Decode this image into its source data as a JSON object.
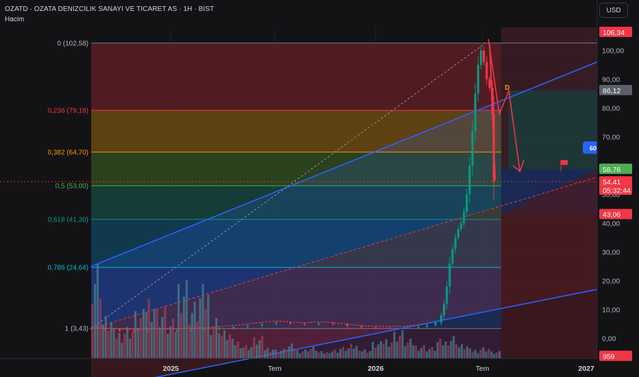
{
  "header": {
    "symbol_line": "OZATD · OZATA DENIZCILIK SANAYI VE TICARET AS · 1H · BIST",
    "volume_label": "Hacim"
  },
  "currency_button": "USD",
  "chart_data": {
    "type": "candlestick",
    "title": "OZATD · OZATA DENIZCILIK SANAYI VE TICARET AS · 1H · BIST",
    "y_axis": {
      "ylim": [
        -7,
        108
      ],
      "tick_labels": [
        "100,00",
        "90,00",
        "80,00",
        "70,00",
        "60,00",
        "50,00",
        "40,00",
        "30,00",
        "20,00",
        "10,00",
        "0,00"
      ],
      "tick_values": [
        100,
        90,
        80,
        70,
        60,
        50,
        40,
        30,
        20,
        10,
        0
      ]
    },
    "x_axis": {
      "tick_labels": [
        "2025",
        "Tem",
        "2026",
        "Tem",
        "2027"
      ],
      "tick_positions": [
        0.28,
        0.645,
        1.0,
        1.375,
        1.74
      ]
    },
    "fibonacci": {
      "levels": [
        {
          "label": "0 (102,58)",
          "value": 102.58,
          "line": "#787b86",
          "fill": "#5c1f24",
          "text": "#b2b5be"
        },
        {
          "label": "0,236 (79,18)",
          "value": 79.18,
          "line": "#f23645",
          "fill": "#6b4a12",
          "text": "#f23645"
        },
        {
          "label": "0,382 (64,70)",
          "value": 64.7,
          "line": "#ff9800",
          "fill": "#2f4a1f",
          "text": "#ff9800"
        },
        {
          "label": "0,5 (53,00)",
          "value": 53.0,
          "line": "#4caf50",
          "fill": "#16443c",
          "text": "#4caf50"
        },
        {
          "label": "0,618 (41,30)",
          "value": 41.3,
          "line": "#089981",
          "fill": "#124158",
          "text": "#089981"
        },
        {
          "label": "0,786 (24,64)",
          "value": 24.64,
          "line": "#00bcd4",
          "fill": "#1d2f5c",
          "text": "#00bcd4"
        },
        {
          "label": "1 (3,43)",
          "value": 3.43,
          "line": "#787b86",
          "fill": null,
          "text": "#b2b5be"
        }
      ]
    },
    "price_labels": [
      {
        "text": "106,34",
        "value": 106.34,
        "color": "#f23645"
      },
      {
        "text": "86,12",
        "value": 86.12,
        "color": "#5d606b"
      },
      {
        "text": "58,76",
        "value": 58.76,
        "color": "#4caf50"
      },
      {
        "text": "54,41",
        "value": 54.41,
        "color": "#f23645"
      },
      {
        "text": "05:32:44",
        "value": 51.5,
        "color": "#f23645"
      },
      {
        "text": "43,06",
        "value": 43.06,
        "color": "#f23645"
      },
      {
        "text": "959",
        "value": -6.2,
        "color": "#f23645"
      }
    ],
    "annotations": {
      "pattern_point": "D",
      "alert_badge": "60"
    },
    "series_close": [
      {
        "t": 0.0,
        "v": 3.4
      },
      {
        "t": 0.05,
        "v": 3.0
      },
      {
        "t": 0.1,
        "v": 2.6
      },
      {
        "t": 0.15,
        "v": 2.4
      },
      {
        "t": 0.2,
        "v": 2.5
      },
      {
        "t": 0.25,
        "v": 2.6
      },
      {
        "t": 0.3,
        "v": 2.7
      },
      {
        "t": 0.35,
        "v": 2.9
      },
      {
        "t": 0.4,
        "v": 3.1
      },
      {
        "t": 0.45,
        "v": 3.5
      },
      {
        "t": 0.5,
        "v": 3.9
      },
      {
        "t": 0.55,
        "v": 4.4
      },
      {
        "t": 0.6,
        "v": 5.0
      },
      {
        "t": 0.65,
        "v": 5.4
      },
      {
        "t": 0.7,
        "v": 5.1
      },
      {
        "t": 0.75,
        "v": 4.8
      },
      {
        "t": 0.8,
        "v": 5.2
      },
      {
        "t": 0.85,
        "v": 4.9
      },
      {
        "t": 0.9,
        "v": 4.3
      },
      {
        "t": 0.95,
        "v": 3.8
      },
      {
        "t": 1.0,
        "v": 3.6
      },
      {
        "t": 1.05,
        "v": 3.5
      },
      {
        "t": 1.1,
        "v": 3.6
      },
      {
        "t": 1.15,
        "v": 4.0
      },
      {
        "t": 1.18,
        "v": 4.6
      },
      {
        "t": 1.21,
        "v": 5.5
      },
      {
        "t": 1.23,
        "v": 8.0
      },
      {
        "t": 1.24,
        "v": 12.0
      },
      {
        "t": 1.25,
        "v": 18.0
      },
      {
        "t": 1.26,
        "v": 26.0
      },
      {
        "t": 1.27,
        "v": 31.0
      },
      {
        "t": 1.28,
        "v": 35.0
      },
      {
        "t": 1.29,
        "v": 38.0
      },
      {
        "t": 1.3,
        "v": 40.0
      },
      {
        "t": 1.31,
        "v": 44.0
      },
      {
        "t": 1.32,
        "v": 50.0
      },
      {
        "t": 1.33,
        "v": 60.0
      },
      {
        "t": 1.34,
        "v": 72.0
      },
      {
        "t": 1.35,
        "v": 85.0
      },
      {
        "t": 1.36,
        "v": 95.0
      },
      {
        "t": 1.37,
        "v": 100.0
      },
      {
        "t": 1.38,
        "v": 96.0
      },
      {
        "t": 1.39,
        "v": 90.0
      },
      {
        "t": 1.4,
        "v": 87.0
      },
      {
        "t": 1.41,
        "v": 78.0
      },
      {
        "t": 1.415,
        "v": 54.41
      }
    ],
    "volume": [
      42,
      18,
      12,
      14,
      20,
      28,
      22,
      16,
      35,
      24,
      30,
      18,
      12,
      8,
      6,
      9,
      5,
      4,
      6,
      4,
      5,
      3,
      4,
      5,
      6,
      4,
      7,
      9,
      12,
      8,
      6,
      5,
      8,
      10,
      6,
      4,
      5,
      3
    ],
    "volume_unit_max": 4200
  }
}
